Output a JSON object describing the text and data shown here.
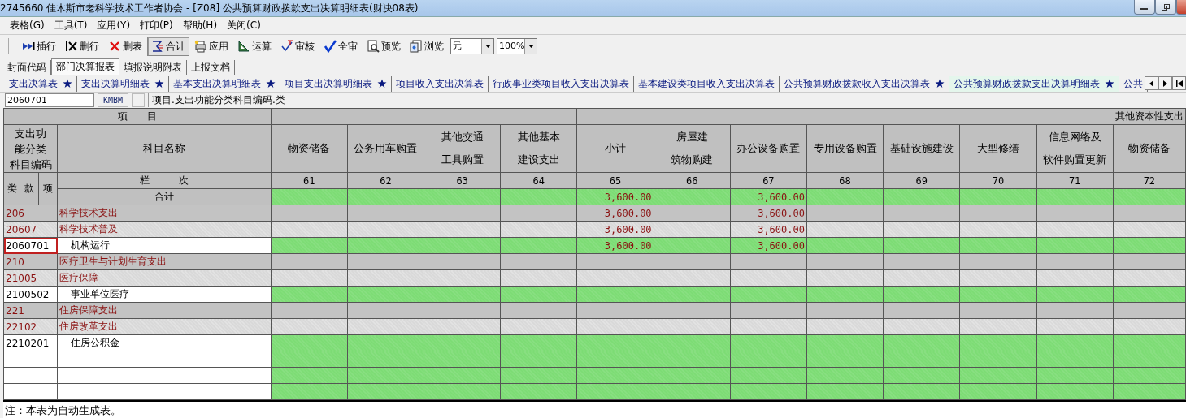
{
  "window": {
    "title": "2745660 佳木斯市老科学技术工作者协会 - [Z08] 公共预算财政拨款支出决算明细表(财决08表)"
  },
  "menu": [
    "表格(G)",
    "工具(T)",
    "应用(Y)",
    "打印(P)",
    "帮助(H)",
    "关闭(C)"
  ],
  "toolbar": [
    {
      "label": "插行",
      "pressed": false
    },
    {
      "label": "删行",
      "pressed": false
    },
    {
      "label": "删表",
      "pressed": false
    },
    {
      "label": "合计",
      "pressed": true
    },
    {
      "label": "应用",
      "pressed": false
    },
    {
      "label": "运算",
      "pressed": false
    },
    {
      "label": "审核",
      "pressed": false
    },
    {
      "label": "全审",
      "pressed": false
    },
    {
      "label": "预览",
      "pressed": false
    },
    {
      "label": "浏览",
      "pressed": false
    }
  ],
  "unit_select": {
    "value": "元"
  },
  "zoom_select": {
    "value": "100%"
  },
  "tabs": [
    {
      "label": "封面代码",
      "selected": false
    },
    {
      "label": "部门决算报表",
      "selected": true
    },
    {
      "label": "填报说明附表",
      "selected": false
    },
    {
      "label": "上报文档",
      "selected": false
    }
  ],
  "sheet_tabs": [
    {
      "label": "支出决算表",
      "starred": true,
      "selected": false
    },
    {
      "label": "支出决算明细表",
      "starred": true,
      "selected": false
    },
    {
      "label": "基本支出决算明细表",
      "starred": true,
      "selected": false
    },
    {
      "label": "项目支出决算明细表",
      "starred": true,
      "selected": false
    },
    {
      "label": "项目收入支出决算表",
      "starred": false,
      "selected": false
    },
    {
      "label": "行政事业类项目收入支出决算表",
      "starred": false,
      "selected": false
    },
    {
      "label": "基本建设类项目收入支出决算表",
      "starred": false,
      "selected": false
    },
    {
      "label": "公共预算财政拨款收入支出决算表",
      "starred": true,
      "selected": false
    },
    {
      "label": "公共预算财政拨款支出决算明细表",
      "starred": true,
      "selected": true
    },
    {
      "label": "公共",
      "starred": false,
      "selected": false
    }
  ],
  "cell_bar": {
    "value": "2060701",
    "field_code": "KMBM",
    "description": "项目.支出功能分类科目编码.类"
  },
  "table": {
    "item_header": "项　　目",
    "group_header": "其他资本性支出",
    "code_header": "支出功能分类科目编码",
    "name_header": "科目名称",
    "index_label": "栏　　　次",
    "code_parts": [
      "类",
      "款",
      "项"
    ],
    "columns": [
      {
        "name": "物资储备",
        "no": "61"
      },
      {
        "name": "公务用车购置",
        "no": "62"
      },
      {
        "name": "其他交通工具购置",
        "no": "63"
      },
      {
        "name": "其他基本建设支出",
        "no": "64"
      },
      {
        "name": "小计",
        "no": "65"
      },
      {
        "name": "房屋建筑物购建",
        "no": "66"
      },
      {
        "name": "办公设备购置",
        "no": "67"
      },
      {
        "name": "专用设备购置",
        "no": "68"
      },
      {
        "name": "基础设施建设",
        "no": "69"
      },
      {
        "name": "大型修缮",
        "no": "70"
      },
      {
        "name": "信息网络及软件购置更新",
        "no": "71"
      },
      {
        "name": "物资储备",
        "no": "72"
      }
    ],
    "total": {
      "label": "合计",
      "subtotal": "3,600.00",
      "office_equipment": "3,600.00"
    },
    "rows": [
      {
        "kind": "class",
        "code": "206",
        "name": "科学技术支出",
        "selected": false,
        "subtotal": "3,600.00",
        "office_equipment": "3,600.00"
      },
      {
        "kind": "section",
        "code": "20607",
        "name": "科学技术普及",
        "selected": false,
        "subtotal": "3,600.00",
        "office_equipment": "3,600.00"
      },
      {
        "kind": "item",
        "code": "2060701",
        "name": "机构运行",
        "selected": true,
        "subtotal": "3,600.00",
        "office_equipment": "3,600.00"
      },
      {
        "kind": "class",
        "code": "210",
        "name": "医疗卫生与计划生育支出",
        "selected": false
      },
      {
        "kind": "section",
        "code": "21005",
        "name": "医疗保障",
        "selected": false
      },
      {
        "kind": "item",
        "code": "2100502",
        "name": "事业单位医疗",
        "selected": false
      },
      {
        "kind": "class",
        "code": "221",
        "name": "住房保障支出",
        "selected": false
      },
      {
        "kind": "section",
        "code": "22102",
        "name": "住房改革支出",
        "selected": false
      },
      {
        "kind": "item",
        "code": "2210201",
        "name": "住房公积金",
        "selected": false
      }
    ]
  },
  "note": "注：本表为自动生成表。"
}
